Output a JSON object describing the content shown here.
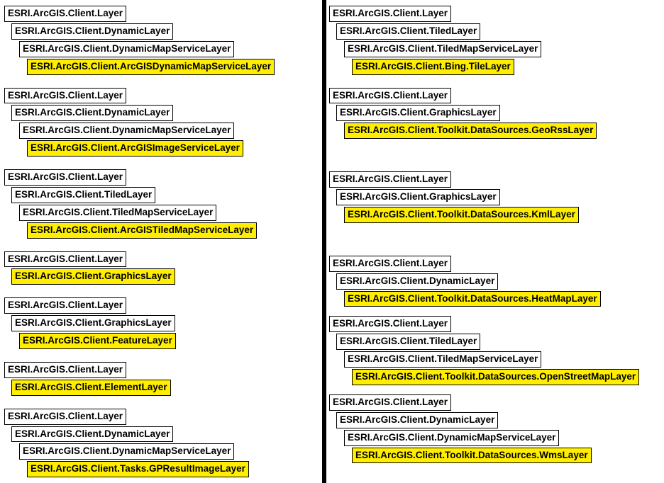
{
  "columns": {
    "left": [
      [
        {
          "text": "ESRI.ArcGIS.Client.Layer",
          "indent": 0,
          "hl": false
        },
        {
          "text": "ESRI.ArcGIS.Client.DynamicLayer",
          "indent": 1,
          "hl": false
        },
        {
          "text": "ESRI.ArcGIS.Client.DynamicMapServiceLayer",
          "indent": 2,
          "hl": false
        },
        {
          "text": "ESRI.ArcGIS.Client.ArcGISDynamicMapServiceLayer",
          "indent": 3,
          "hl": true
        }
      ],
      [
        {
          "text": "ESRI.ArcGIS.Client.Layer",
          "indent": 0,
          "hl": false
        },
        {
          "text": "ESRI.ArcGIS.Client.DynamicLayer",
          "indent": 1,
          "hl": false
        },
        {
          "text": "ESRI.ArcGIS.Client.DynamicMapServiceLayer",
          "indent": 2,
          "hl": false
        },
        {
          "text": "ESRI.ArcGIS.Client.ArcGISImageServiceLayer",
          "indent": 3,
          "hl": true
        }
      ],
      [
        {
          "text": "ESRI.ArcGIS.Client.Layer",
          "indent": 0,
          "hl": false
        },
        {
          "text": "ESRI.ArcGIS.Client.TiledLayer",
          "indent": 1,
          "hl": false
        },
        {
          "text": "ESRI.ArcGIS.Client.TiledMapServiceLayer",
          "indent": 2,
          "hl": false
        },
        {
          "text": "ESRI.ArcGIS.Client.ArcGISTiledMapServiceLayer",
          "indent": 3,
          "hl": true
        }
      ],
      [
        {
          "text": "ESRI.ArcGIS.Client.Layer",
          "indent": 0,
          "hl": false
        },
        {
          "text": "ESRI.ArcGIS.Client.GraphicsLayer",
          "indent": 1,
          "hl": true
        }
      ],
      [
        {
          "text": "ESRI.ArcGIS.Client.Layer",
          "indent": 0,
          "hl": false
        },
        {
          "text": "ESRI.ArcGIS.Client.GraphicsLayer",
          "indent": 1,
          "hl": false
        },
        {
          "text": "ESRI.ArcGIS.Client.FeatureLayer",
          "indent": 2,
          "hl": true
        }
      ],
      [
        {
          "text": "ESRI.ArcGIS.Client.Layer",
          "indent": 0,
          "hl": false
        },
        {
          "text": "ESRI.ArcGIS.Client.ElementLayer",
          "indent": 1,
          "hl": true
        }
      ],
      [
        {
          "text": "ESRI.ArcGIS.Client.Layer",
          "indent": 0,
          "hl": false
        },
        {
          "text": "ESRI.ArcGIS.Client.DynamicLayer",
          "indent": 1,
          "hl": false
        },
        {
          "text": "ESRI.ArcGIS.Client.DynamicMapServiceLayer",
          "indent": 2,
          "hl": false
        },
        {
          "text": "ESRI.ArcGIS.Client.Tasks.GPResultImageLayer",
          "indent": 3,
          "hl": true
        }
      ]
    ],
    "right": [
      [
        {
          "text": "ESRI.ArcGIS.Client.Layer",
          "indent": 0,
          "hl": false
        },
        {
          "text": "ESRI.ArcGIS.Client.TiledLayer",
          "indent": 1,
          "hl": false
        },
        {
          "text": "ESRI.ArcGIS.Client.TiledMapServiceLayer",
          "indent": 2,
          "hl": false
        },
        {
          "text": "ESRI.ArcGIS.Client.Bing.TileLayer",
          "indent": 3,
          "hl": true
        }
      ],
      [
        {
          "text": "ESRI.ArcGIS.Client.Layer",
          "indent": 0,
          "hl": false
        },
        {
          "text": "ESRI.ArcGIS.Client.GraphicsLayer",
          "indent": 1,
          "hl": false
        },
        {
          "text": "ESRI.ArcGIS.Client.Toolkit.DataSources.GeoRssLayer",
          "indent": 2,
          "hl": true
        }
      ],
      [
        {
          "text": "ESRI.ArcGIS.Client.Layer",
          "indent": 0,
          "hl": false
        },
        {
          "text": "ESRI.ArcGIS.Client.GraphicsLayer",
          "indent": 1,
          "hl": false
        },
        {
          "text": "ESRI.ArcGIS.Client.Toolkit.DataSources.KmlLayer",
          "indent": 2,
          "hl": true
        }
      ],
      [
        {
          "text": "ESRI.ArcGIS.Client.Layer",
          "indent": 0,
          "hl": false
        },
        {
          "text": "ESRI.ArcGIS.Client.DynamicLayer",
          "indent": 1,
          "hl": false
        },
        {
          "text": "ESRI.ArcGIS.Client.Toolkit.DataSources.HeatMapLayer",
          "indent": 2,
          "hl": true
        }
      ],
      [
        {
          "text": "ESRI.ArcGIS.Client.Layer",
          "indent": 0,
          "hl": false
        },
        {
          "text": "ESRI.ArcGIS.Client.TiledLayer",
          "indent": 1,
          "hl": false
        },
        {
          "text": "ESRI.ArcGIS.Client.TiledMapServiceLayer",
          "indent": 2,
          "hl": false
        },
        {
          "text": "ESRI.ArcGIS.Client.Toolkit.DataSources.OpenStreetMapLayer",
          "indent": 3,
          "hl": true
        }
      ],
      [
        {
          "text": "ESRI.ArcGIS.Client.Layer",
          "indent": 0,
          "hl": false
        },
        {
          "text": "ESRI.ArcGIS.Client.DynamicLayer",
          "indent": 1,
          "hl": false
        },
        {
          "text": "ESRI.ArcGIS.Client.DynamicMapServiceLayer",
          "indent": 2,
          "hl": false
        },
        {
          "text": "ESRI.ArcGIS.Client.Toolkit.DataSources.WmsLayer",
          "indent": 3,
          "hl": true
        }
      ]
    ]
  },
  "right_group_gaps": [
    16,
    44,
    44,
    11,
    11,
    11
  ]
}
